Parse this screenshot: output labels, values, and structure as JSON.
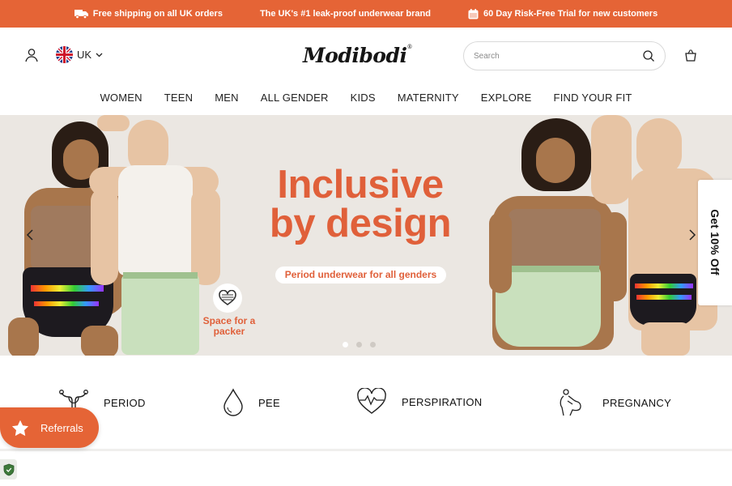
{
  "announcement": {
    "items": [
      {
        "icon": "truck-icon",
        "text": "Free shipping on all UK orders"
      },
      {
        "icon": "",
        "text": "The UK's #1 leak-proof underwear brand"
      },
      {
        "icon": "calendar-icon",
        "text": "60 Day Risk-Free Trial for new customers"
      }
    ]
  },
  "header": {
    "locale": "UK",
    "logo": "Modibodi",
    "logo_mark": "®",
    "search_placeholder": "Search"
  },
  "nav": {
    "items": [
      "WOMEN",
      "TEEN",
      "MEN",
      "ALL GENDER",
      "KIDS",
      "MATERNITY",
      "EXPLORE",
      "FIND YOUR FIT"
    ]
  },
  "hero": {
    "headline_line1": "Inclusive",
    "headline_line2": "by design",
    "subheadline": "Period underwear for all genders",
    "badge_text": "Space for a packer",
    "slides_total": 3,
    "active_slide": 1
  },
  "side_tab": {
    "label": "Get 10% Off"
  },
  "categories": [
    {
      "icon": "uterus-icon",
      "label": "PERIOD"
    },
    {
      "icon": "droplet-icon",
      "label": "PEE"
    },
    {
      "icon": "heartbeat-icon",
      "label": "PERSPIRATION"
    },
    {
      "icon": "pregnancy-icon",
      "label": "PREGNANCY"
    }
  ],
  "referrals": {
    "label": "Referrals"
  },
  "colors": {
    "brand_orange": "#e56436",
    "headline_orange": "#e0603a",
    "hero_bg": "#ebe7e2"
  }
}
